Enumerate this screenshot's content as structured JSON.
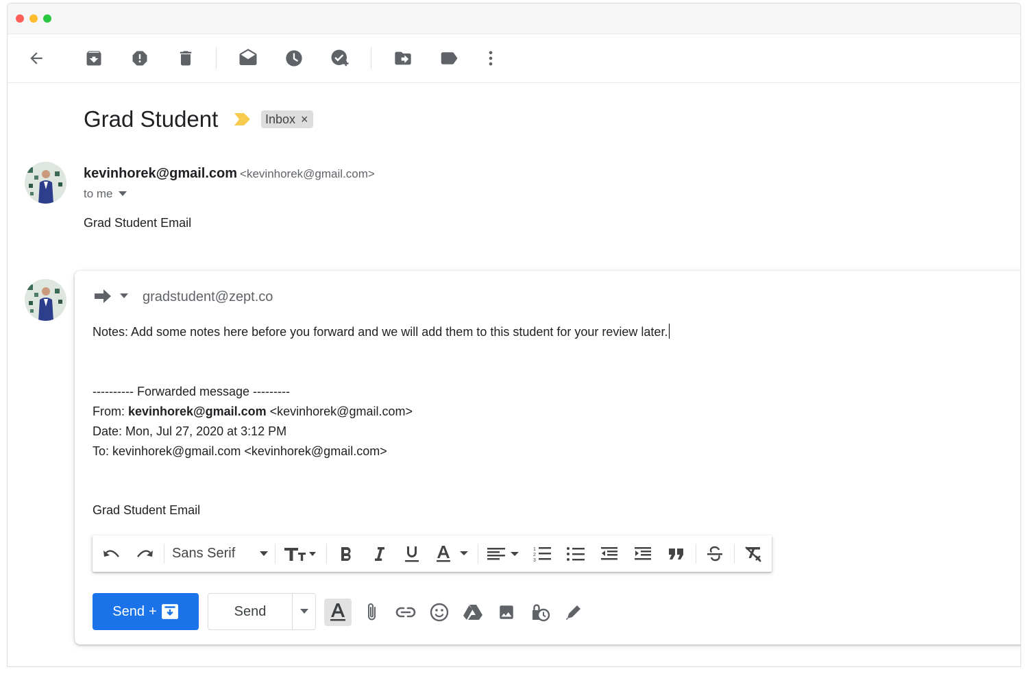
{
  "window": {
    "traffic_lights": [
      "close",
      "minimize",
      "zoom"
    ]
  },
  "toolbar": {
    "icons": [
      "back-arrow-icon",
      "archive-icon",
      "report-spam-icon",
      "delete-icon",
      "mark-unread-icon",
      "snooze-icon",
      "add-to-tasks-icon",
      "move-to-icon",
      "label-icon",
      "more-vert-icon"
    ]
  },
  "thread": {
    "subject": "Grad Student",
    "label": "Inbox",
    "label_remove": "×"
  },
  "message": {
    "sender_name": "kevinhorek@gmail.com",
    "sender_email": "<kevinhorek@gmail.com>",
    "to_line": "to me",
    "body": "Grad Student Email"
  },
  "compose": {
    "recipient": "gradstudent@zept.co",
    "notes": "Notes: Add some notes here before you forward and we will add them to this student for your review later.",
    "forward_header": "---------- Forwarded message ---------",
    "from_prefix": "From: ",
    "from_name": "kevinhorek@gmail.com",
    "from_email": " <kevinhorek@gmail.com>",
    "date_line": "Date: Mon, Jul 27, 2020 at 3:12 PM",
    "to_line": "To: kevinhorek@gmail.com <kevinhorek@gmail.com>",
    "quoted_body": "Grad Student Email"
  },
  "formatting": {
    "font": "Sans Serif"
  },
  "actions": {
    "send_archive_label": "Send",
    "send_archive_plus": "+",
    "send_label": "Send"
  },
  "colors": {
    "primary": "#1a73e8",
    "importance": "#f7cb4d",
    "chip": "#dddddd"
  }
}
